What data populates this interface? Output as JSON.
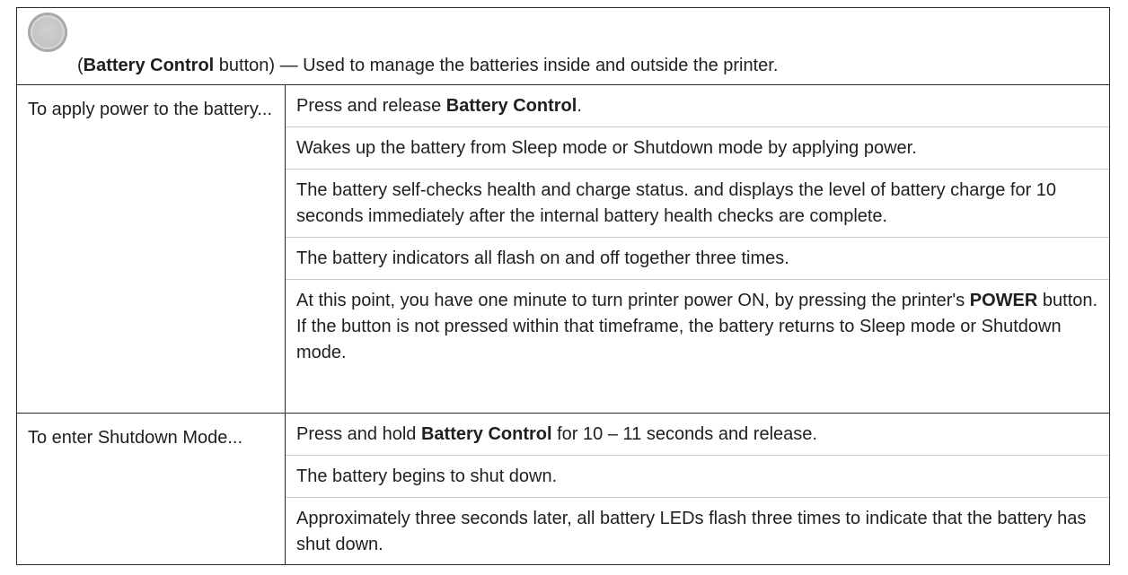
{
  "header": {
    "open_paren": "(",
    "button_name": "Battery Control",
    "rest": " button) — Used to manage the batteries inside and outside the printer."
  },
  "rows": [
    {
      "label": "To apply power to the battery...",
      "p1_pre": "Press and release ",
      "p1_bold": "Battery Control",
      "p1_post": ".",
      "p2": "Wakes up the battery from Sleep mode or Shutdown mode by applying power.",
      "p3": "The battery self-checks health and charge status. and displays the level of battery charge for 10 seconds immediately after the internal battery health checks are complete.",
      "p4": "The battery indicators all flash on and off together three times.",
      "p5_pre": "At this point, you have one minute to turn printer power ON, by pressing the printer's ",
      "p5_bold": "POWER",
      "p5_post": " button. If the button is not pressed within that timeframe, the battery returns to Sleep mode or Shutdown mode."
    },
    {
      "label": "To enter Shutdown Mode...",
      "p1_pre": "Press and hold ",
      "p1_bold": "Battery Control",
      "p1_post": " for 10 – 11 seconds and release.",
      "p2": "The battery begins to shut down.",
      "p3": "Approximately three seconds later, all battery LEDs flash three times to indicate that the battery has shut down."
    }
  ]
}
